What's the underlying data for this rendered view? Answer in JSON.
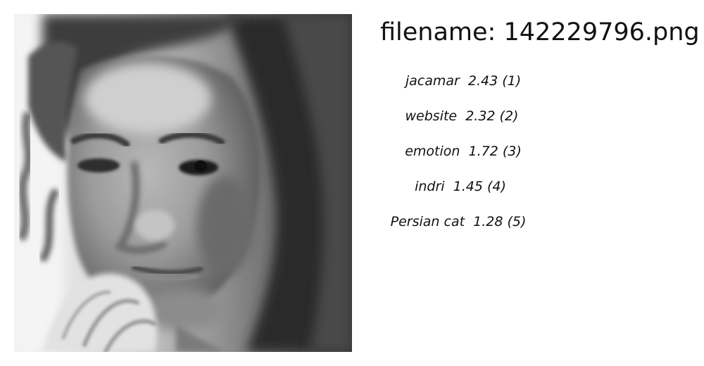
{
  "filename": "filename: 142229796.png",
  "image": {
    "subject": "grayscale close-up portrait photo"
  },
  "predictions": [
    {
      "label": "jacamar",
      "score": "2.43",
      "rank": "(1)",
      "text": "jacamar  2.43 (1)"
    },
    {
      "label": "website",
      "score": "2.32",
      "rank": "(2)",
      "text": "website  2.32 (2)"
    },
    {
      "label": "emotion",
      "score": "1.72",
      "rank": "(3)",
      "text": "emotion  1.72 (3)"
    },
    {
      "label": "indri",
      "score": "1.45",
      "rank": "(4)",
      "text": "indri  1.45 (4)"
    },
    {
      "label": "Persian cat",
      "score": "1.28",
      "rank": "(5)",
      "text": "Persian cat  1.28 (5)"
    }
  ]
}
